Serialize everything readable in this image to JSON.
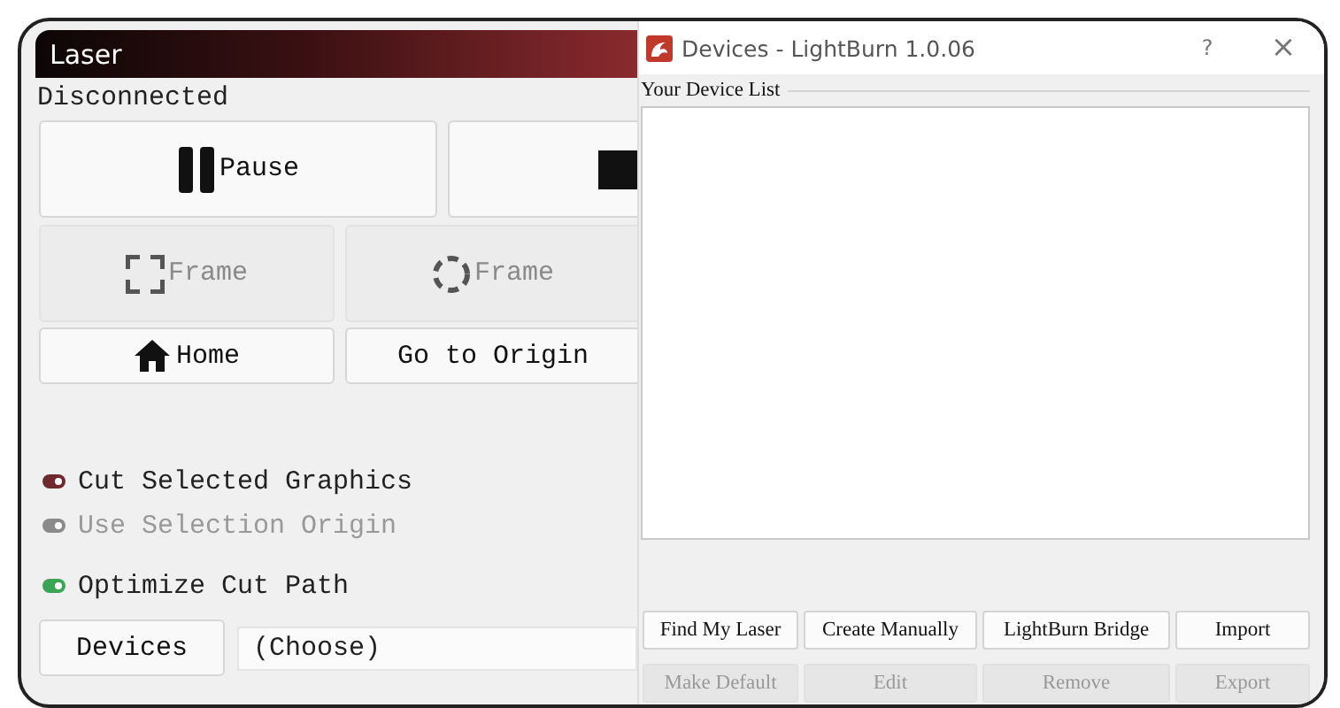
{
  "laser": {
    "title": "Laser",
    "status": "Disconnected",
    "buttons": [
      {
        "kind": "pause",
        "label": "Pause",
        "disabled": false
      },
      {
        "kind": "stop",
        "disabled": false
      },
      {
        "kind": "frame-rect",
        "label": "Frame",
        "disabled": true
      },
      {
        "kind": "frame-circle",
        "label": "Frame",
        "disabled": true
      },
      {
        "kind": "home",
        "label": "Home",
        "disabled": false
      },
      {
        "kind": "origin",
        "label": "Go to Origin",
        "disabled": false
      }
    ],
    "toggles": [
      {
        "label": "Cut Selected Graphics",
        "on": true,
        "disabled": false,
        "color": "#6e2a2e"
      },
      {
        "label": "Use Selection Origin",
        "on": true,
        "disabled": true,
        "color": "#8a8a8a"
      },
      {
        "label": "Optimize Cut Path",
        "on": true,
        "disabled": false,
        "color": "#3aa655"
      }
    ],
    "devices_button": "Devices",
    "device_select": "(Choose)"
  },
  "dialog": {
    "title": "Devices - LightBurn 1.0.06",
    "help": "?",
    "close": "×",
    "group_label": "Your Device List",
    "buttons": [
      {
        "label": "Find My Laser",
        "disabled": false
      },
      {
        "label": "Create Manually",
        "disabled": false
      },
      {
        "label": "LightBurn Bridge",
        "disabled": false
      },
      {
        "label": "Import",
        "disabled": false
      },
      {
        "label": "Make Default",
        "disabled": true
      },
      {
        "label": "Edit",
        "disabled": true
      },
      {
        "label": "Remove",
        "disabled": true
      },
      {
        "label": "Export",
        "disabled": true
      }
    ]
  }
}
